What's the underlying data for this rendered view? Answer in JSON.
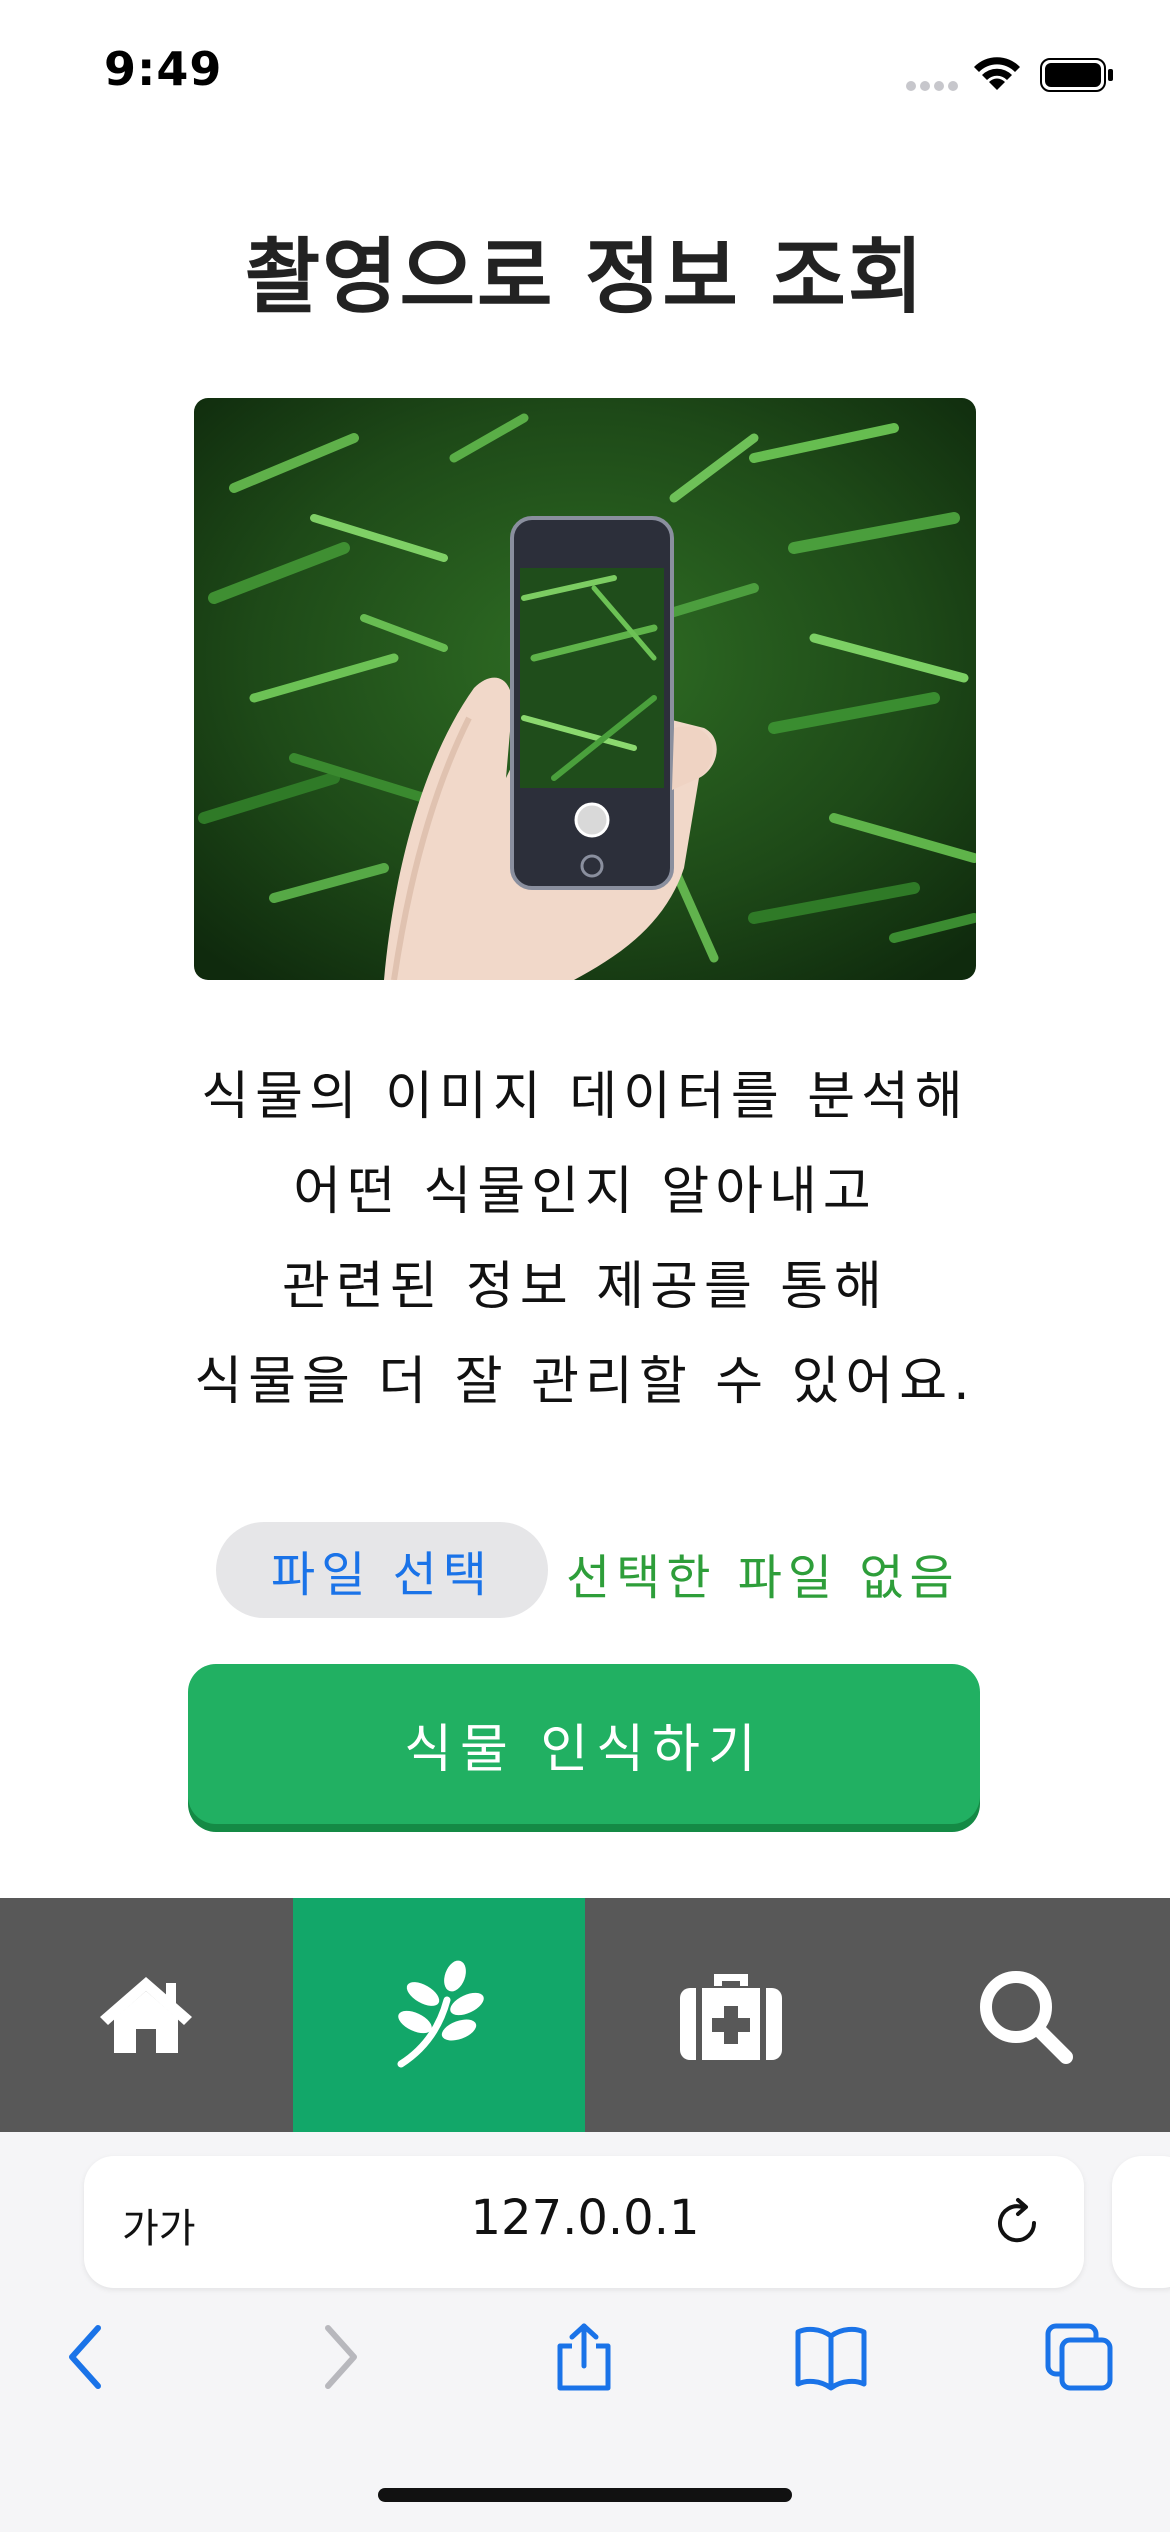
{
  "status_bar": {
    "time": "9:49"
  },
  "page": {
    "title": "촬영으로 정보 조회",
    "description_lines": [
      "식물의 이미지 데이터를 분석해",
      "어떤 식물인지 알아내고",
      "관련된 정보 제공를 통해",
      "식물을 더 잘 관리할 수 있어요."
    ],
    "file_button_label": "파일 선택",
    "file_status": "선택한 파일 없음",
    "identify_button_label": "식물 인식하기"
  },
  "bottom_nav": {
    "items": [
      {
        "icon": "home-icon",
        "active": false
      },
      {
        "icon": "plant-icon",
        "active": true
      },
      {
        "icon": "medical-kit-icon",
        "active": false
      },
      {
        "icon": "search-icon",
        "active": false
      }
    ],
    "active_color": "#12a769",
    "background_color": "#585858"
  },
  "browser": {
    "text_size_label": "가가",
    "url": "127.0.0.1"
  },
  "colors": {
    "primary_button": "#21b062",
    "file_button_text": "#1a73e8",
    "file_status_text": "#2e9e3a"
  }
}
